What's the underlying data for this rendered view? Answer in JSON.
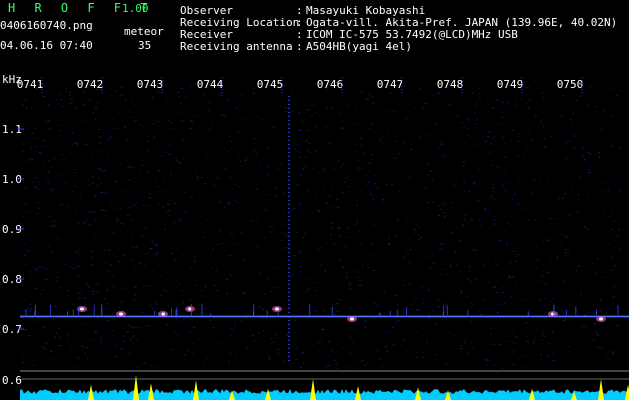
{
  "header": {
    "app_title": "H R O F F T",
    "app_version": "1.00",
    "filename": "0406160740.png",
    "meteor_label": "meteor",
    "meteor_count": "35",
    "datetime": "04.06.16 07:40"
  },
  "info": [
    {
      "label": "Observer",
      "value": "Masayuki Kobayashi"
    },
    {
      "label": "Receiving Location",
      "value": "Ogata-vill. Akita-Pref. JAPAN (139.96E, 40.02N)"
    },
    {
      "label": "Receiver",
      "value": "ICOM IC-575 53.7492(@LCD)MHz USB"
    },
    {
      "label": "Receiving antenna",
      "value": "A504HB(yagi 4el)"
    }
  ],
  "colon": ":",
  "colors": {
    "background": "#000000",
    "text": "#ffffff",
    "title": "#33ff66",
    "signal": "#3344ff",
    "noise": "#1a1a70",
    "level": "#00ccff",
    "peak": "#ffff00",
    "tick": "#3333ff"
  },
  "chart_data": {
    "type": "heatmap",
    "y_unit_label": "kHz",
    "x_ticks": [
      "0741",
      "0742",
      "0743",
      "0744",
      "0745",
      "0746",
      "0747",
      "0748",
      "0749",
      "0750"
    ],
    "y_ticks": [
      1.1,
      1.0,
      0.9,
      0.8,
      0.7,
      0.6
    ],
    "ylim": [
      0.6,
      1.18
    ],
    "xlim": [
      0,
      10
    ],
    "carrier_khz": 0.725,
    "vertical_streak_minute": 4.15,
    "bottom_panel": "signal level",
    "level_peaks": [
      {
        "minute": 0.85,
        "level": 0.55
      },
      {
        "minute": 1.6,
        "level": 0.9
      },
      {
        "minute": 1.85,
        "level": 0.6
      },
      {
        "minute": 2.6,
        "level": 0.7
      },
      {
        "minute": 3.2,
        "level": 0.35
      },
      {
        "minute": 3.8,
        "level": 0.4
      },
      {
        "minute": 4.55,
        "level": 0.75
      },
      {
        "minute": 5.3,
        "level": 0.5
      },
      {
        "minute": 6.3,
        "level": 0.45
      },
      {
        "minute": 6.8,
        "level": 0.35
      },
      {
        "minute": 8.2,
        "level": 0.4
      },
      {
        "minute": 8.9,
        "level": 0.3
      },
      {
        "minute": 9.35,
        "level": 0.75
      },
      {
        "minute": 9.8,
        "level": 0.55
      }
    ],
    "meteor_echoes": [
      {
        "minute": 0.7,
        "khz": 0.74
      },
      {
        "minute": 1.35,
        "khz": 0.73
      },
      {
        "minute": 2.05,
        "khz": 0.73
      },
      {
        "minute": 2.5,
        "khz": 0.74
      },
      {
        "minute": 3.95,
        "khz": 0.74
      },
      {
        "minute": 5.2,
        "khz": 0.72
      },
      {
        "minute": 8.55,
        "khz": 0.73
      },
      {
        "minute": 9.35,
        "khz": 0.72
      }
    ]
  }
}
